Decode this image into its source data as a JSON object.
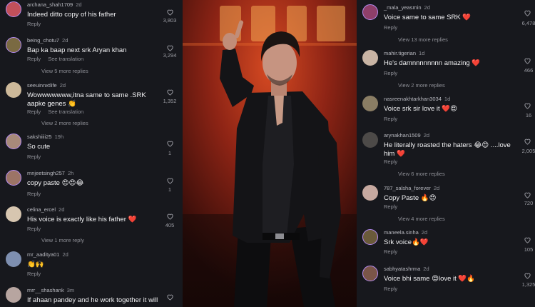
{
  "left_comments": [
    {
      "user": "archana_shah1709",
      "ago": "2d",
      "text": "Indeed ditto copy of his father",
      "reply": "Reply",
      "see_translation": "",
      "likes": "3,803",
      "more": ""
    },
    {
      "user": "being_chotu7",
      "ago": "2d",
      "text": "Bap ka baap next srk Aryan khan",
      "reply": "Reply",
      "see_translation": "See translation",
      "likes": "3,294",
      "more": "View 5 more replies"
    },
    {
      "user": "seeuinnxtlife",
      "ago": "2d",
      "text": "Wowwwwwww,itna same to same .SRK aapke genes 👏",
      "reply": "Reply",
      "see_translation": "See translation",
      "likes": "1,352",
      "more": "View 2 more replies"
    },
    {
      "user": "sakshiiii25",
      "ago": "19h",
      "text": "So cute",
      "reply": "Reply",
      "see_translation": "",
      "likes": "1",
      "more": ""
    },
    {
      "user": "mnjeetsingh257",
      "ago": "2h",
      "text": "copy paste 😍😍😂",
      "reply": "Reply",
      "see_translation": "",
      "likes": "1",
      "more": ""
    },
    {
      "user": "celina_ercel",
      "ago": "2d",
      "text": "His voice is exactly like his father ❤️",
      "reply": "Reply",
      "see_translation": "",
      "likes": "405",
      "more": "View 1 more reply"
    },
    {
      "user": "mr_aaditya01",
      "ago": "2d",
      "text": "👏🙌",
      "reply": "Reply",
      "see_translation": "",
      "likes": "",
      "more": ""
    },
    {
      "user": "mrr__shashank",
      "ago": "3m",
      "text": "If ahaan pandey and he work together it will",
      "reply": "",
      "see_translation": "",
      "likes": "",
      "more": ""
    }
  ],
  "right_comments": [
    {
      "user": "_mala_yeasmin",
      "ago": "2d",
      "text": "Voice same to same SRK ❤️",
      "reply": "Reply",
      "likes": "6,478",
      "more": "View 13 more replies"
    },
    {
      "user": "mahir.tigerian",
      "ago": "1d",
      "text": "He's damnnnnnnnn amazing ❤️",
      "reply": "Reply",
      "likes": "466",
      "more": "View 2 more replies"
    },
    {
      "user": "nasreenakhtarkhan3034",
      "ago": "1d",
      "text": "Voice srk sir love it ❤️😍",
      "reply": "Reply",
      "likes": "16",
      "more": ""
    },
    {
      "user": "arynakhan1509",
      "ago": "2d",
      "text": "He literally roasted the haters 😂😍 ....love him ❤️",
      "reply": "Reply",
      "likes": "2,005",
      "more": "View 6 more replies"
    },
    {
      "user": "787_salsha_forever",
      "ago": "2d",
      "text": "Copy Paste 🔥😍",
      "reply": "Reply",
      "likes": "720",
      "more": "View 4 more replies"
    },
    {
      "user": "maneela.sinha",
      "ago": "2d",
      "text": "Srk voice🔥❤️",
      "reply": "Reply",
      "likes": "105",
      "more": ""
    },
    {
      "user": "sabhyatashrma",
      "ago": "2d",
      "text": "Voice bhi same 😍love it ❤️🔥",
      "reply": "Reply",
      "likes": "1,325",
      "more": ""
    }
  ]
}
